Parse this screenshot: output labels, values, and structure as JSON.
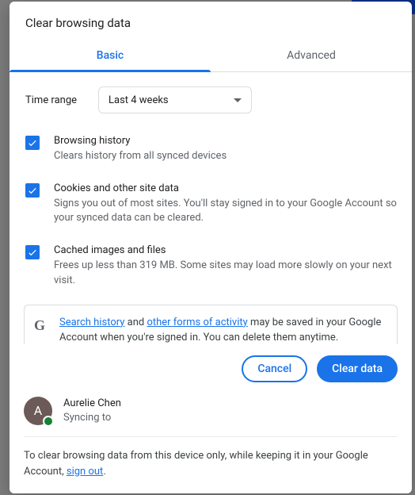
{
  "title": "Clear browsing data",
  "tabs": {
    "basic": "Basic",
    "advanced": "Advanced"
  },
  "timeRange": {
    "label": "Time range",
    "selected": "Last 4 weeks"
  },
  "items": [
    {
      "title": "Browsing history",
      "desc": "Clears history from all synced devices",
      "checked": true
    },
    {
      "title": "Cookies and other site data",
      "desc": "Signs you out of most sites. You'll stay signed in to your Google Account so your synced data can be cleared.",
      "checked": true
    },
    {
      "title": "Cached images and files",
      "desc": "Frees up less than 319 MB. Some sites may load more slowly on your next visit.",
      "checked": true
    }
  ],
  "infobox": {
    "link1": "Search history",
    "mid1": " and ",
    "link2": "other forms of activity",
    "tail": " may be saved in your Google Account when you're signed in. You can delete them anytime."
  },
  "buttons": {
    "cancel": "Cancel",
    "clear": "Clear data"
  },
  "account": {
    "initial": "A",
    "name": "Aurelie Chen",
    "status": "Syncing to"
  },
  "note": {
    "pre": "To clear browsing data from this device only, while keeping it in your Google Account, ",
    "link": "sign out",
    "post": "."
  }
}
